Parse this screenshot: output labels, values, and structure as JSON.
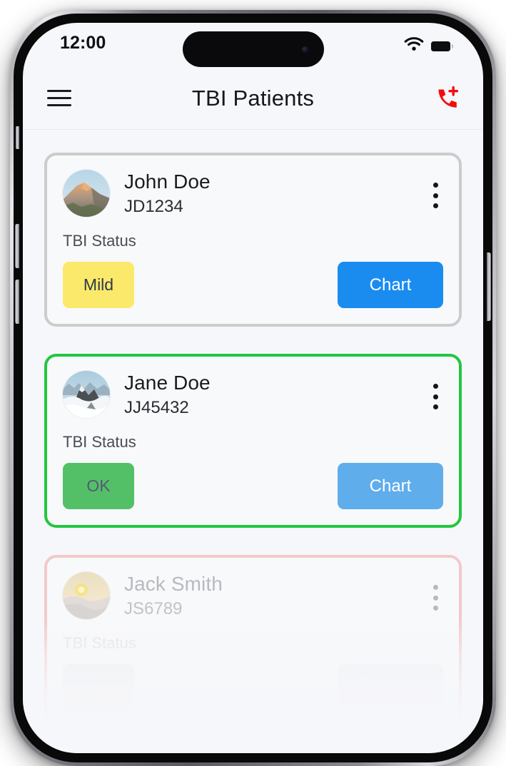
{
  "device": {
    "name": "smartphone-mockup",
    "frame_color": "#8a8a90",
    "screen_bg": "#f6f7fa"
  },
  "status_bar": {
    "time": "12:00",
    "wifi_icon": "wifi-icon",
    "battery_icon": "battery-full-icon",
    "battery_level": 100,
    "island_camera_icon": "front-camera-icon"
  },
  "header": {
    "menu_icon": "hamburger-menu-icon",
    "title": "TBI Patients",
    "action_icon": "phone-add-icon",
    "action_icon_color": "#f40c0c"
  },
  "patients": [
    {
      "name": "John Doe",
      "id": "JD1234",
      "status_label": "TBI Status",
      "status_value": "Mild",
      "status_bg": "#fbe96c",
      "status_text_color": "#2c3a4a",
      "border_color": "#f9e223",
      "chart_label": "Chart",
      "chart_bg": "#1a8cf0",
      "avatar_icon": "rock-cliff-photo-avatar",
      "menu_icon": "kebab-menu-icon"
    },
    {
      "name": "Jane Doe",
      "id": "JJ45432",
      "status_label": "TBI Status",
      "status_value": "OK",
      "status_bg": "#53c068",
      "status_text_color": "#565a74",
      "border_color": "#22c740",
      "chart_label": "Chart",
      "chart_bg": "#5fadeb",
      "avatar_icon": "snow-mountain-photo-avatar",
      "menu_icon": "kebab-menu-icon"
    },
    {
      "name": "Jack Smith",
      "id": "JS6789",
      "status_label": "TBI Status",
      "status_value": "",
      "status_bg": "#f0eff1",
      "status_text_color": "#f0eff1",
      "border_color": "#f3c9c9",
      "chart_label": "",
      "chart_bg": "#f1f1f4",
      "avatar_icon": "sunrise-hills-photo-avatar",
      "menu_icon": "kebab-menu-icon"
    }
  ]
}
